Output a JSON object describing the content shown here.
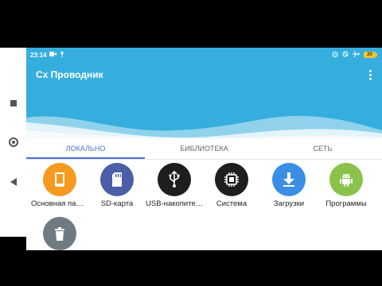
{
  "status_bar": {
    "time": "23:14",
    "left_icons": [
      "video-camera-icon",
      "usb-debug-icon"
    ],
    "right_icons": [
      "alarm-icon",
      "no-sim-icon",
      "airplane-icon"
    ],
    "battery": "20",
    "battery_color": "#f5c52b"
  },
  "app": {
    "title": "Cx Проводник",
    "accent": "#35aedd",
    "tab_accent": "#4a6fd8"
  },
  "tabs": [
    {
      "label": "ЛОКАЛЬНО",
      "active": true
    },
    {
      "label": "БИБЛИОТЕКА",
      "active": false
    },
    {
      "label": "СЕТЬ",
      "active": false
    }
  ],
  "locations": [
    {
      "label": "Основная память",
      "icon": "phone-icon",
      "color": "#f59a1f"
    },
    {
      "label": "SD-карта",
      "icon": "sd-card-icon",
      "color": "#4a5fa8"
    },
    {
      "label": "USB-накопитель",
      "icon": "usb-icon",
      "color": "#1e1e1e"
    },
    {
      "label": "Система",
      "icon": "chip-icon",
      "color": "#1e1e1e"
    },
    {
      "label": "Загрузки",
      "icon": "download-icon",
      "color": "#3a8ee6"
    },
    {
      "label": "Программы",
      "icon": "android-icon",
      "color": "#8bc34a"
    },
    {
      "label": "",
      "icon": "trash-icon",
      "color": "#6e7b82"
    }
  ]
}
